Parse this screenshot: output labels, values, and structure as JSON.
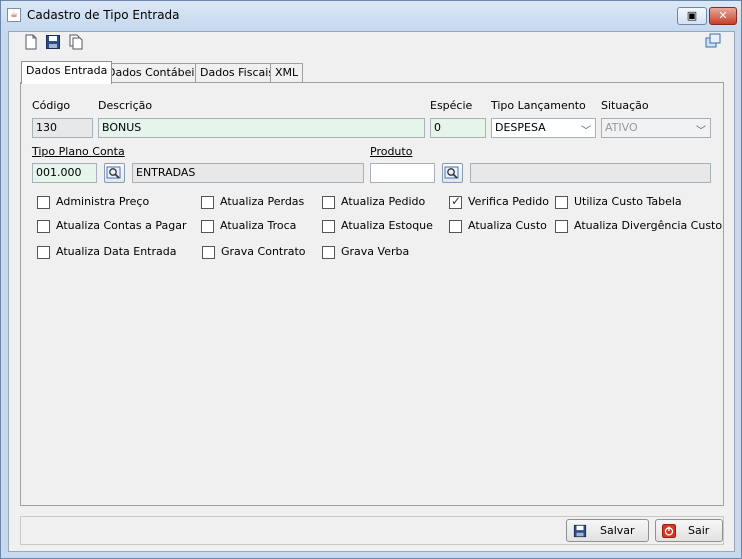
{
  "window": {
    "title": "Cadastro de Tipo Entrada",
    "minimize_label": "▣",
    "close_label": "✕"
  },
  "toolbar": {
    "icons": [
      "new-document-icon",
      "save-icon",
      "copy-icon"
    ],
    "restore_icon": "windows-icon"
  },
  "tabs": [
    {
      "label": "Dados Entrada",
      "active": true
    },
    {
      "label": "Dados Contábeis",
      "active": false
    },
    {
      "label": "Dados Fiscais",
      "active": false
    },
    {
      "label": "XML",
      "active": false
    }
  ],
  "form": {
    "codigo": {
      "label": "Código",
      "value": "130"
    },
    "descricao": {
      "label": "Descrição",
      "value": "BONUS"
    },
    "especie": {
      "label": "Espécie",
      "value": "0"
    },
    "tipo_lancamento": {
      "label": "Tipo Lançamento",
      "value": "DESPESA"
    },
    "situacao": {
      "label": "Situação",
      "value": "ATIVO"
    },
    "tipo_plano_conta": {
      "label": "Tipo Plano Conta",
      "code": "001.000",
      "description": "ENTRADAS"
    },
    "produto": {
      "label": "Produto",
      "code": "",
      "description": ""
    }
  },
  "checkboxes": [
    {
      "label": "Administra Preço",
      "checked": false
    },
    {
      "label": "Atualiza Perdas",
      "checked": false
    },
    {
      "label": "Atualiza Pedido",
      "checked": false
    },
    {
      "label": "Verifica Pedido",
      "checked": true
    },
    {
      "label": "Utiliza Custo Tabela",
      "checked": false
    },
    {
      "label": "Atualiza Contas a Pagar",
      "checked": false
    },
    {
      "label": "Atualiza Troca",
      "checked": false
    },
    {
      "label": "Atualiza Estoque",
      "checked": false
    },
    {
      "label": "Atualiza Custo",
      "checked": false
    },
    {
      "label": "Atualiza Divergência Custo",
      "checked": false
    },
    {
      "label": "Atualiza Data Entrada",
      "checked": false
    },
    {
      "label": "Grava Contrato",
      "checked": false
    },
    {
      "label": "Grava Verba",
      "checked": false
    }
  ],
  "buttons": {
    "salvar": "Salvar",
    "sair": "Sair"
  }
}
